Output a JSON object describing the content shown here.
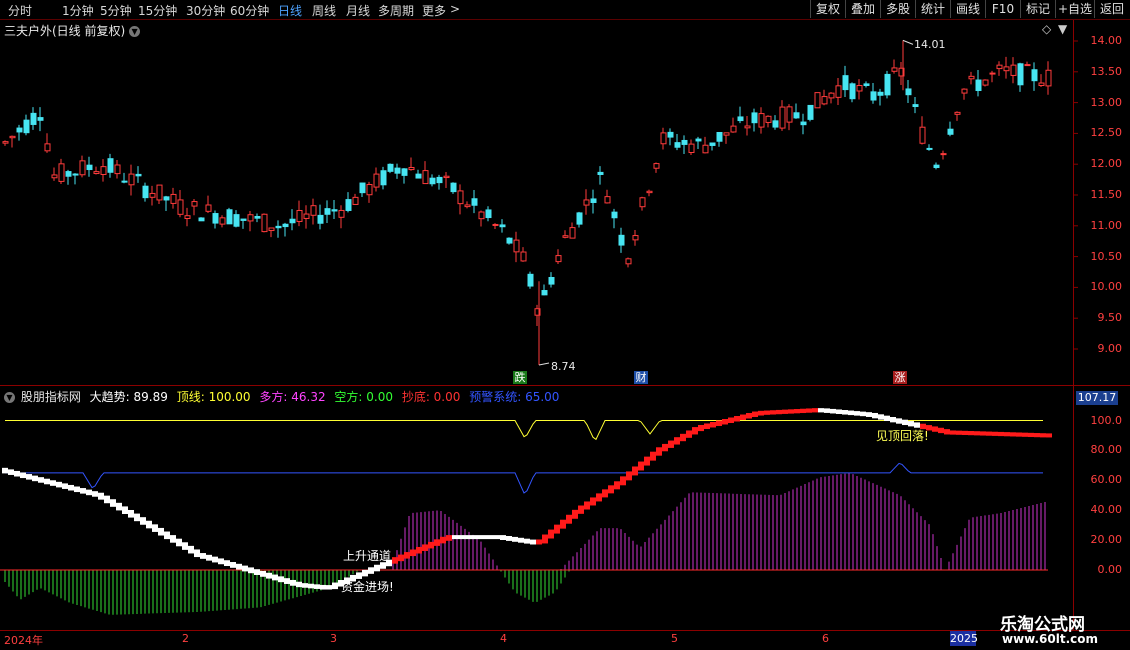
{
  "toolbar": {
    "periods": [
      "分时",
      "1分钟",
      "5分钟",
      "15分钟",
      "30分钟",
      "60分钟",
      "日线",
      "周线",
      "月线",
      "多周期",
      "更多"
    ],
    "active_period": "日线",
    "more_arrow": ">",
    "right_buttons": [
      "复权",
      "叠加",
      "多股",
      "统计",
      "画线",
      "F10",
      "标记",
      "+自选",
      "返回"
    ]
  },
  "main_chart": {
    "title": "三夫户外(日线 前复权)",
    "high_label": "14.01",
    "low_label": "8.74",
    "price_ticks": [
      "14.00",
      "13.50",
      "13.00",
      "12.50",
      "12.00",
      "11.50",
      "11.00",
      "10.50",
      "10.00",
      "9.50",
      "9.00"
    ],
    "events": [
      {
        "text": "跌",
        "color": "#1a7a1a"
      },
      {
        "text": "财",
        "color": "#1e4fa8"
      },
      {
        "text": "涨",
        "color": "#a81e1e"
      }
    ],
    "colors": {
      "up": "#ff3b3b",
      "down": "#47e5f2"
    }
  },
  "indicator": {
    "name": "股朋指标网",
    "items": [
      {
        "label": "大趋势:",
        "value": "89.89",
        "color": "#ffffff"
      },
      {
        "label": "顶线:",
        "value": "100.00",
        "color": "#ffff33"
      },
      {
        "label": "多方:",
        "value": "46.32",
        "color": "#ff44ff"
      },
      {
        "label": "空方:",
        "value": "0.00",
        "color": "#33ff33"
      },
      {
        "label": "抄底:",
        "value": "0.00",
        "color": "#ff3333"
      },
      {
        "label": "预警系统:",
        "value": "65.00",
        "color": "#3355ff"
      }
    ],
    "current_value": "107.17",
    "ticks": [
      "100.0",
      "80.00",
      "60.00",
      "40.00",
      "20.00",
      "0.00"
    ],
    "annotations": {
      "rise_channel": "上升通道",
      "fund_entry": "资金进场!",
      "top_fall": "见顶回落!"
    }
  },
  "date_axis": {
    "labels": [
      "2024年",
      "2",
      "3",
      "4",
      "5",
      "6"
    ],
    "current_year": "2025"
  },
  "watermark": {
    "line1": "乐淘公式网",
    "line2": "www.60lt.com"
  }
}
